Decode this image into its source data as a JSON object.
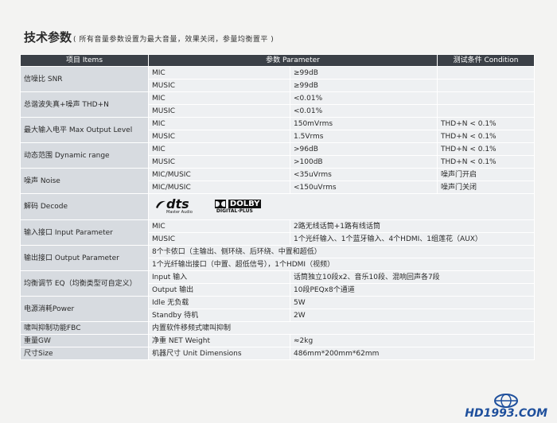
{
  "page": {
    "title": "技术参数",
    "subtitle": "( 所有音量参数设置为最大音量，效果关闭，参量均衡置平 )"
  },
  "table": {
    "headers": [
      "项目 Items",
      "参数 Parameter",
      "测试条件 Condition"
    ],
    "rows": {
      "snr": {
        "item": "信噪比 SNR",
        "sub": [
          [
            "MIC",
            "≥99dB",
            ""
          ],
          [
            "MUSIC",
            "≥99dB",
            ""
          ]
        ]
      },
      "thd": {
        "item": "总谐波失真+噪声 THD+N",
        "sub": [
          [
            "MIC",
            "<0.01%",
            ""
          ],
          [
            "MUSIC",
            "<0.01%",
            ""
          ]
        ]
      },
      "max_output": {
        "item": "最大输入电平 Max Output Level",
        "sub": [
          [
            "MIC",
            "150mVrms",
            "THD+N < 0.1%"
          ],
          [
            "MUSIC",
            "1.5Vrms",
            "THD+N < 0.1%"
          ]
        ]
      },
      "dynamic": {
        "item": "动态范围 Dynamic range",
        "sub": [
          [
            "MIC",
            ">96dB",
            "THD+N < 0.1%"
          ],
          [
            "MUSIC",
            ">100dB",
            "THD+N < 0.1%"
          ]
        ]
      },
      "noise": {
        "item": "噪声 Noise",
        "sub": [
          [
            "MIC/MUSIC",
            "<35uVrms",
            "噪声门开启"
          ],
          [
            "MIC/MUSIC",
            "<150uVrms",
            "噪声门关闭"
          ]
        ]
      },
      "decode": {
        "item": "解码 Decode",
        "dts_mark": "dts",
        "dts_sub": "Master Audio",
        "dolby_mark": "DOLBY",
        "dolby_sub": "DIGITAL·PLUS"
      },
      "input": {
        "item": "输入接口 Input Parameter",
        "sub": [
          [
            "MIC",
            "2路无线话筒+1路有线话筒"
          ],
          [
            "MUSIC",
            "1个光纤输入、1个蓝牙输入、4个HDMI、1组莲花（AUX）"
          ]
        ]
      },
      "output": {
        "item": "输出接口 Output Parameter",
        "lines": [
          "8个卡侬口（主输出、侧环绕、后环绕、中置和超低）",
          "1个光纤输出接口（中置、超低信号），1个HDMI（视频）"
        ]
      },
      "eq": {
        "item": "均衡调节 EQ（均衡类型可自定义）",
        "sub": [
          [
            "Input 输入",
            "话筒独立10段x2、音乐10段、混响回声各7段"
          ],
          [
            "Output 输出",
            "10段PEQx8个通道"
          ]
        ]
      },
      "power": {
        "item": "电源消耗Power",
        "sub": [
          [
            "Idle 无负载",
            "5W"
          ],
          [
            "Standby 待机",
            "2W"
          ]
        ]
      },
      "fbc": {
        "item": "啸叫抑制功能FBC",
        "value": "内置软件移频式啸叫抑制"
      },
      "weight": {
        "item": "重量GW",
        "label": "净重 NET Weight",
        "value": "≈2kg"
      },
      "size": {
        "item": "尺寸Size",
        "label": "机器尺寸 Unit Dimensions",
        "value": "486mm*200mm*62mm"
      }
    }
  },
  "watermark": {
    "text": "HD1993.COM"
  },
  "colors": {
    "header_bg": "#3b4047",
    "item_bg": "#d7dbe0",
    "cell_bg": "#eef0f2",
    "page_bg": "#f3f3f2"
  }
}
